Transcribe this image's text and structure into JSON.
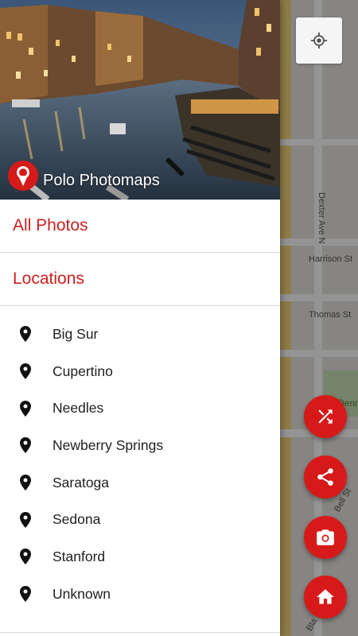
{
  "drawer": {
    "app_name": "Polo Photomaps",
    "sections": {
      "all_photos": "All Photos",
      "locations": "Locations"
    },
    "locations": [
      "Big Sur",
      "Cupertino",
      "Needles",
      "Newberry Springs",
      "Saratoga",
      "Sedona",
      "Stanford",
      "Unknown"
    ]
  },
  "map": {
    "street_labels": {
      "dexter": "Dexter Ave N",
      "harrison": "Harrison St",
      "thomas": "Thomas St",
      "bell": "Bell St",
      "bla": "Bla",
      "park": "Denn"
    }
  },
  "fabs": [
    "shuffle-icon",
    "share-icon",
    "camera-icon",
    "home-icon"
  ],
  "colors": {
    "accent": "#cc1f1f",
    "fab": "#d61a1a",
    "drawer_bg": "#ffffff"
  }
}
